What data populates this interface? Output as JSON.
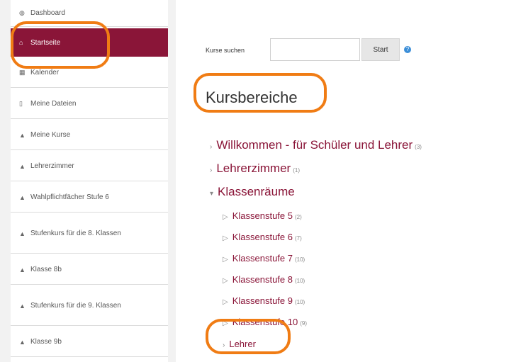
{
  "sidebar": {
    "items": [
      {
        "label": "Dashboard",
        "icon": "tachometer-icon"
      },
      {
        "label": "Startseite",
        "icon": "home-icon",
        "active": true
      },
      {
        "label": "Kalender",
        "icon": "calendar-icon"
      },
      {
        "label": "Meine Dateien",
        "icon": "file-icon"
      },
      {
        "label": "Meine Kurse",
        "icon": "graduation-cap-icon"
      },
      {
        "label": "Lehrerzimmer",
        "icon": "graduation-cap-icon"
      },
      {
        "label": "Wahlpflichtfächer Stufe 6",
        "icon": "graduation-cap-icon"
      },
      {
        "label": "Stufenkurs für die 8. Klassen",
        "icon": "graduation-cap-icon"
      },
      {
        "label": "Klasse 8b",
        "icon": "graduation-cap-icon"
      },
      {
        "label": "Stufenkurs für die 9. Klassen",
        "icon": "graduation-cap-icon"
      },
      {
        "label": "Klasse 9b",
        "icon": "graduation-cap-icon"
      }
    ]
  },
  "search": {
    "label": "Kurse suchen",
    "value": "",
    "button": "Start",
    "help_icon": "question-circle-icon"
  },
  "main": {
    "title": "Kursbereiche",
    "categories": [
      {
        "label": "Willkommen - für Schüler und Lehrer",
        "count": "(3)",
        "arrow": "›"
      },
      {
        "label": "Lehrerzimmer",
        "count": "(1)",
        "arrow": "›"
      },
      {
        "label": "Klassenräume",
        "count": "",
        "arrow": "▾"
      },
      {
        "label": "Klassenstufe 5",
        "count": "(2)",
        "arrow": "▷"
      },
      {
        "label": "Klassenstufe 6",
        "count": "(7)",
        "arrow": "▷"
      },
      {
        "label": "Klassenstufe 7",
        "count": "(10)",
        "arrow": "▷"
      },
      {
        "label": "Klassenstufe 8",
        "count": "(10)",
        "arrow": "▷"
      },
      {
        "label": "Klassenstufe 9",
        "count": "(10)",
        "arrow": "▷"
      },
      {
        "label": "Klassenstufe 10",
        "count": "(9)",
        "arrow": "▷"
      },
      {
        "label": "Lehrer",
        "count": "",
        "arrow": "›"
      }
    ]
  },
  "colors": {
    "accent": "#8a1538",
    "highlight": "#f07c14"
  }
}
